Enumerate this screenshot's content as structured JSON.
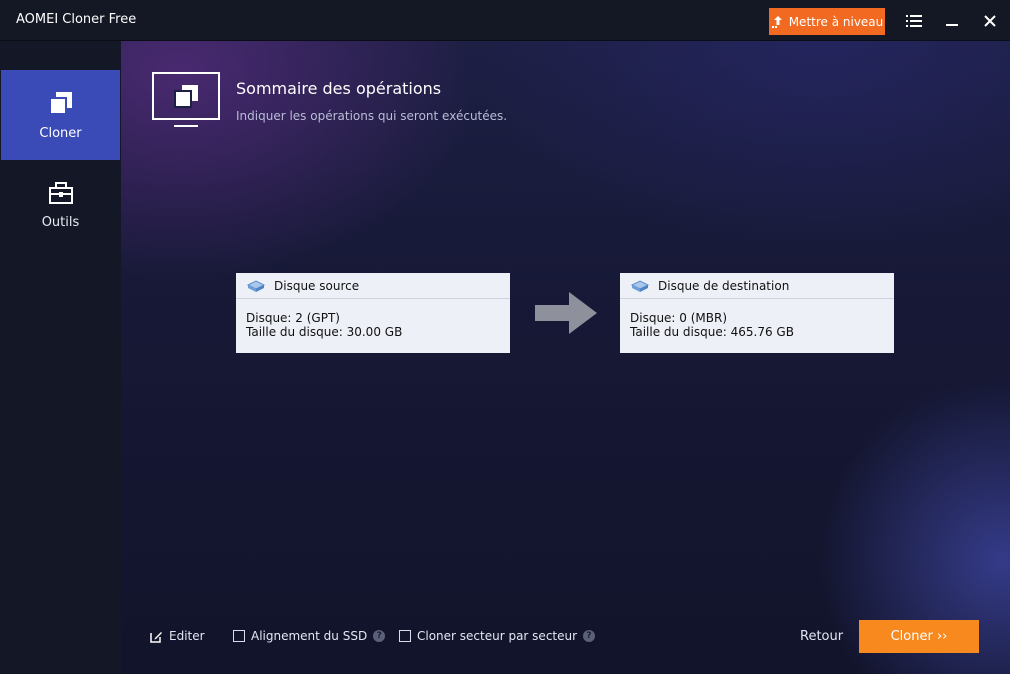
{
  "window": {
    "title": "AOMEI Cloner Free",
    "upgrade_label": "Mettre à niveau",
    "controls": [
      "menu-icon",
      "minimize-icon",
      "close-icon"
    ]
  },
  "sidebar": {
    "items": [
      {
        "label": "Cloner",
        "icon": "clone-icon",
        "active": true
      },
      {
        "label": "Outils",
        "icon": "toolbox-icon",
        "active": false
      }
    ]
  },
  "header": {
    "title": "Sommaire des opérations",
    "subtitle": "Indiquer les opérations qui seront exécutées."
  },
  "source": {
    "title": "Disque source",
    "disk": "Disque: 2 (GPT)",
    "size": "Taille du disque: 30.00 GB"
  },
  "destination": {
    "title": "Disque de destination",
    "disk": "Disque: 0 (MBR)",
    "size": "Taille du disque: 465.76 GB"
  },
  "footer": {
    "edit_label": "Editer",
    "ssd_label": "Alignement du SSD",
    "sector_label": "Cloner secteur par secteur",
    "back_label": "Retour",
    "clone_label": "Cloner ››"
  },
  "colors": {
    "accent_orange": "#f26a21",
    "clone_button": "#f7891f",
    "sidebar_active": "#3a4bb7"
  }
}
